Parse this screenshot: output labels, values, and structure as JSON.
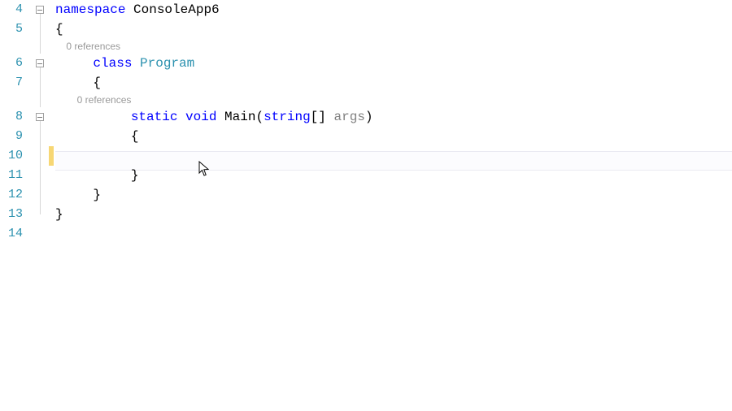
{
  "gutter": {
    "start": 4,
    "end": 14
  },
  "colors": {
    "keyword": "#0000ff",
    "type": "#2b91af",
    "lineNumber": "#2b91af",
    "codelens": "#999999",
    "changeBar": "#f7d774"
  },
  "codelens": {
    "classRefs": "0 references",
    "methodRefs": "0 references"
  },
  "code": {
    "namespaceKw": "namespace",
    "namespaceName": " ConsoleApp6",
    "openBrace": "{",
    "closeBrace": "}",
    "classKw": "class",
    "className": " Program",
    "staticKw": "static",
    "voidKw": " void",
    "methodName": " Main",
    "lparen": "(",
    "paramType": "string",
    "paramBrackets": "[] ",
    "paramName": "args",
    "rparen": ")"
  },
  "currentLine": 10,
  "foldLines": [
    4,
    6,
    8
  ],
  "lightbulbLine": 10,
  "changeBarLine": 10,
  "indent": {
    "n0": "",
    "n1": "    ",
    "n2": "        ",
    "n3": "            "
  },
  "lineNums": {
    "l4": "4",
    "l5": "5",
    "l6": "6",
    "l7": "7",
    "l8": "8",
    "l9": "9",
    "l10": "10",
    "l11": "11",
    "l12": "12",
    "l13": "13",
    "l14": "14"
  }
}
